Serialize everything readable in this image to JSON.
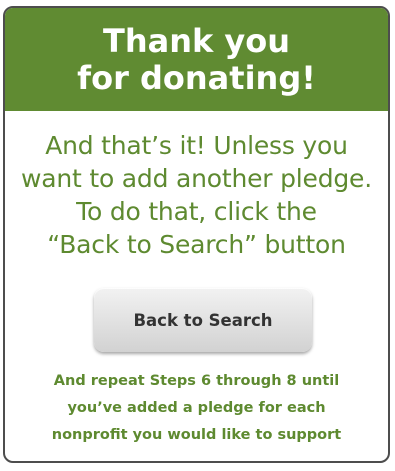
{
  "header": {
    "line1": "Thank you",
    "line2": "for donating!"
  },
  "intro": {
    "line1": "And that’s it! Unless you",
    "line2": "want to add another pledge.",
    "line3": "To do that, click the",
    "line4": "“Back to Search” button"
  },
  "button": {
    "label": "Back to Search"
  },
  "footer": {
    "line1": "And repeat Steps 6 through 8 until",
    "line2": "you’ve added a pledge for each",
    "line3": "nonprofit you would like to support"
  },
  "colors": {
    "header_bg": "#608b32",
    "text_green": "#5e8a30",
    "border": "#4d4d4d"
  }
}
